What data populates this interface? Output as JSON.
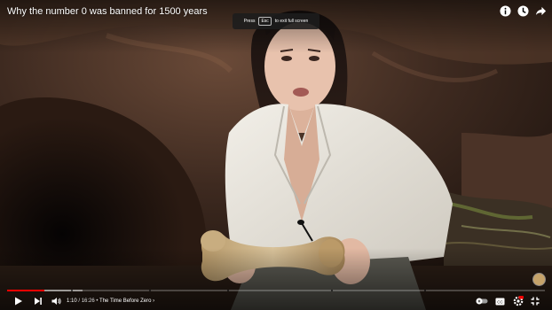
{
  "video": {
    "title": "Why the number 0 was banned for 1500 years"
  },
  "toast": {
    "pre": "Press",
    "key": "Esc",
    "post": "to exit full screen"
  },
  "top_icons": [
    "info-icon",
    "watch-later-clock-icon",
    "share-arrow-icon"
  ],
  "progress": {
    "played_fraction": 0.069,
    "buffered_fraction": 0.14,
    "accent_color": "#ff0000"
  },
  "time": {
    "current": "1:10",
    "separator": " / ",
    "duration": "16:26",
    "bullet": " • ",
    "chapter": "The Time Before Zero",
    "chevron": " ›"
  },
  "controls": {
    "left": [
      "play-icon",
      "next-icon",
      "volume-icon"
    ],
    "right": [
      "autoplay-toggle",
      "subtitles-icon",
      "settings-icon",
      "miniplayer-icon",
      "theater-icon",
      "exit-fullscreen-icon"
    ]
  }
}
